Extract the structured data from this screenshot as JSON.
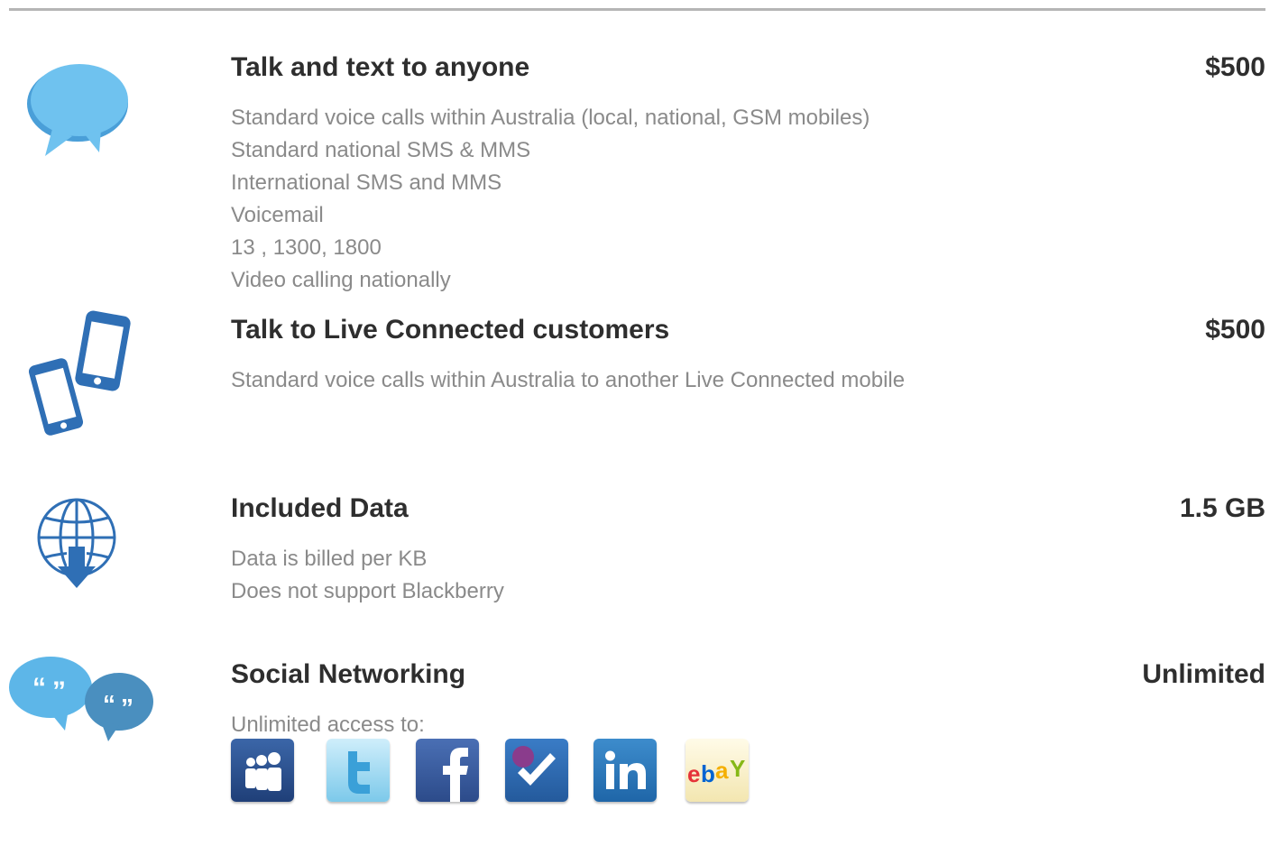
{
  "features": [
    {
      "title": "Talk and text to anyone",
      "value": "$500",
      "icon": "speech-bubble-icon",
      "lines": [
        "Standard voice calls within Australia (local, national, GSM mobiles)",
        "Standard national SMS & MMS",
        "International SMS and MMS",
        "Voicemail",
        "13 , 1300, 1800",
        "Video calling nationally"
      ]
    },
    {
      "title": "Talk to Live Connected customers",
      "value": "$500",
      "icon": "two-phones-icon",
      "lines": [
        "Standard voice calls within Australia to another Live Connected mobile"
      ]
    },
    {
      "title": "Included Data",
      "value": "1.5 GB",
      "icon": "globe-download-icon",
      "lines": [
        "Data is billed per KB",
        "Does not support Blackberry"
      ]
    },
    {
      "title": "Social Networking",
      "value": "Unlimited",
      "icon": "chat-bubbles-icon",
      "lines": [
        "Unlimited access to:"
      ],
      "services": [
        "myspace-icon",
        "twitter-icon",
        "facebook-icon",
        "foursquare-icon",
        "linkedin-icon",
        "ebay-icon"
      ]
    }
  ],
  "colors": {
    "icon_blue": "#2f6fb5",
    "icon_light_blue": "#6fc2ef",
    "title": "#2e2e2e",
    "text": "#8a8a8a",
    "rule": "#b5b5b5"
  }
}
